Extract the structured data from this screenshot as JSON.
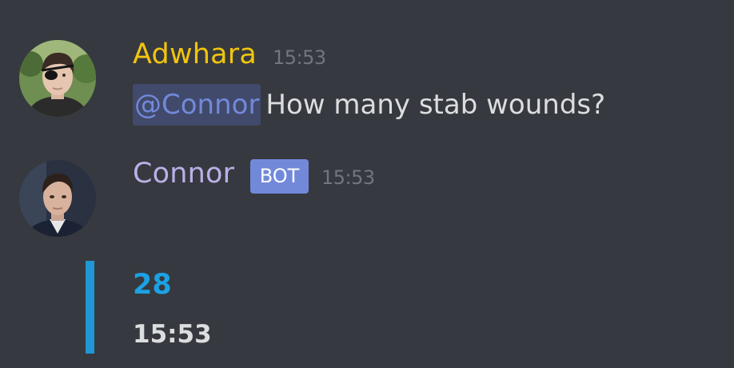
{
  "messages": [
    {
      "username": "Adwhara",
      "username_color": "#f1c40f",
      "timestamp": "15:53",
      "mention": "@Connor",
      "text": "How many stab wounds?"
    },
    {
      "username": "Connor",
      "username_color": "#b9b0e8",
      "bot_tag": "BOT",
      "timestamp": "15:53",
      "embed": {
        "accent_color": "#2196d4",
        "title": "28",
        "footer": "15:53"
      }
    }
  ],
  "colors": {
    "background": "#36393f",
    "timestamp": "#72767d",
    "text": "#dcddde",
    "mention_bg": "#414a6b",
    "mention_text": "#7289da",
    "bot_tag": "#7289da",
    "embed_title": "#1ca1e3"
  }
}
